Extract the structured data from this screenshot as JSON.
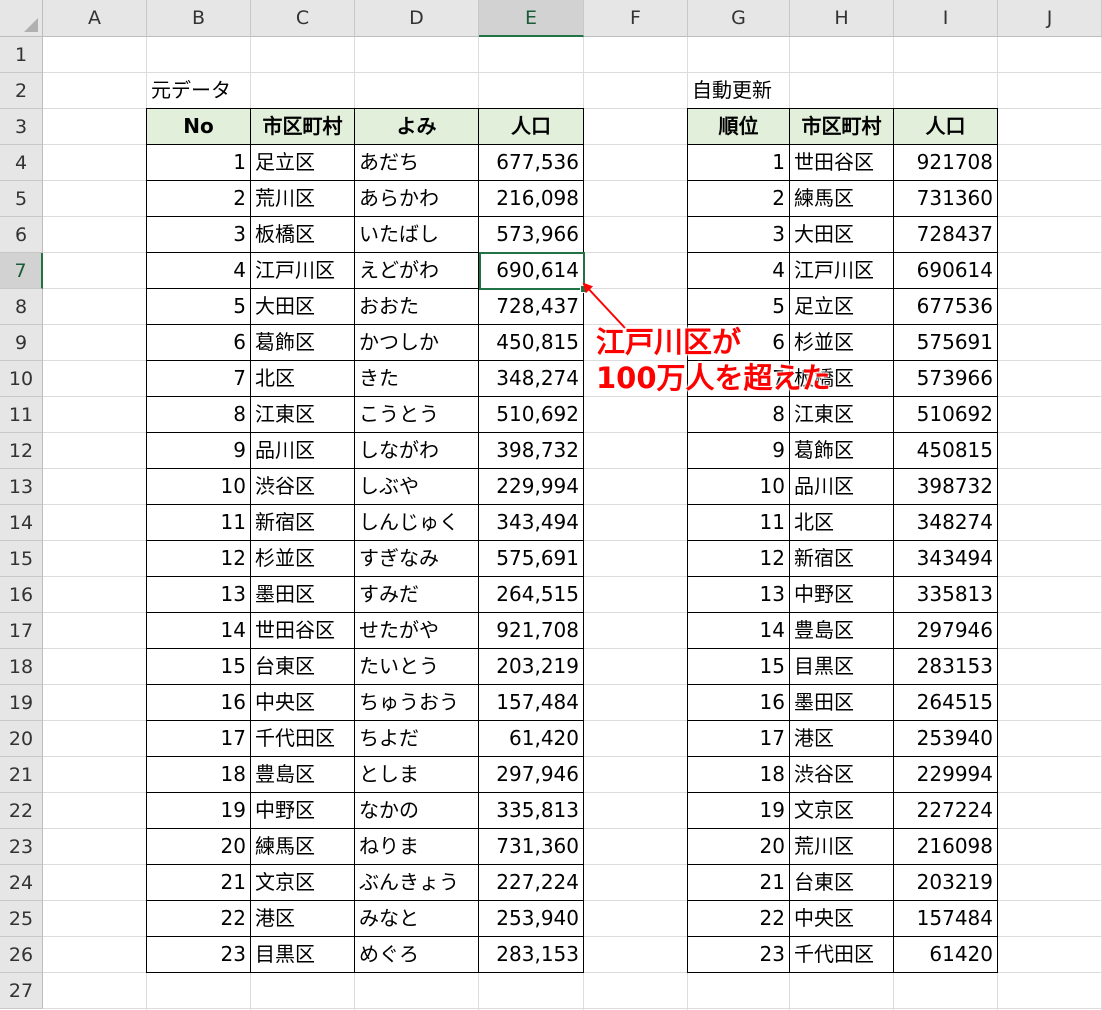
{
  "columns": [
    "A",
    "B",
    "C",
    "D",
    "E",
    "F",
    "G",
    "H",
    "I",
    "J"
  ],
  "rows": [
    "1",
    "2",
    "3",
    "4",
    "5",
    "6",
    "7",
    "8",
    "9",
    "10",
    "11",
    "12",
    "13",
    "14",
    "15",
    "16",
    "17",
    "18",
    "19",
    "20",
    "21",
    "22",
    "23",
    "24",
    "25",
    "26",
    "27"
  ],
  "selected": {
    "column": "E",
    "row": "7"
  },
  "left_table": {
    "title": "元データ",
    "headers": [
      "No",
      "市区町村",
      "よみ",
      "人口"
    ],
    "rows": [
      [
        "1",
        "足立区",
        "あだち",
        "677,536"
      ],
      [
        "2",
        "荒川区",
        "あらかわ",
        "216,098"
      ],
      [
        "3",
        "板橋区",
        "いたばし",
        "573,966"
      ],
      [
        "4",
        "江戸川区",
        "えどがわ",
        "690,614"
      ],
      [
        "5",
        "大田区",
        "おおた",
        "728,437"
      ],
      [
        "6",
        "葛飾区",
        "かつしか",
        "450,815"
      ],
      [
        "7",
        "北区",
        "きた",
        "348,274"
      ],
      [
        "8",
        "江東区",
        "こうとう",
        "510,692"
      ],
      [
        "9",
        "品川区",
        "しながわ",
        "398,732"
      ],
      [
        "10",
        "渋谷区",
        "しぶや",
        "229,994"
      ],
      [
        "11",
        "新宿区",
        "しんじゅく",
        "343,494"
      ],
      [
        "12",
        "杉並区",
        "すぎなみ",
        "575,691"
      ],
      [
        "13",
        "墨田区",
        "すみだ",
        "264,515"
      ],
      [
        "14",
        "世田谷区",
        "せたがや",
        "921,708"
      ],
      [
        "15",
        "台東区",
        "たいとう",
        "203,219"
      ],
      [
        "16",
        "中央区",
        "ちゅうおう",
        "157,484"
      ],
      [
        "17",
        "千代田区",
        "ちよだ",
        "61,420"
      ],
      [
        "18",
        "豊島区",
        "としま",
        "297,946"
      ],
      [
        "19",
        "中野区",
        "なかの",
        "335,813"
      ],
      [
        "20",
        "練馬区",
        "ねりま",
        "731,360"
      ],
      [
        "21",
        "文京区",
        "ぶんきょう",
        "227,224"
      ],
      [
        "22",
        "港区",
        "みなと",
        "253,940"
      ],
      [
        "23",
        "目黒区",
        "めぐろ",
        "283,153"
      ]
    ]
  },
  "right_table": {
    "title": "自動更新",
    "headers": [
      "順位",
      "市区町村",
      "人口"
    ],
    "rows": [
      [
        "1",
        "世田谷区",
        "921708"
      ],
      [
        "2",
        "練馬区",
        "731360"
      ],
      [
        "3",
        "大田区",
        "728437"
      ],
      [
        "4",
        "江戸川区",
        "690614"
      ],
      [
        "5",
        "足立区",
        "677536"
      ],
      [
        "6",
        "杉並区",
        "575691"
      ],
      [
        "7",
        "板橋区",
        "573966"
      ],
      [
        "8",
        "江東区",
        "510692"
      ],
      [
        "9",
        "葛飾区",
        "450815"
      ],
      [
        "10",
        "品川区",
        "398732"
      ],
      [
        "11",
        "北区",
        "348274"
      ],
      [
        "12",
        "新宿区",
        "343494"
      ],
      [
        "13",
        "中野区",
        "335813"
      ],
      [
        "14",
        "豊島区",
        "297946"
      ],
      [
        "15",
        "目黒区",
        "283153"
      ],
      [
        "16",
        "墨田区",
        "264515"
      ],
      [
        "17",
        "港区",
        "253940"
      ],
      [
        "18",
        "渋谷区",
        "229994"
      ],
      [
        "19",
        "文京区",
        "227224"
      ],
      [
        "20",
        "荒川区",
        "216098"
      ],
      [
        "21",
        "台東区",
        "203219"
      ],
      [
        "22",
        "中央区",
        "157484"
      ],
      [
        "23",
        "千代田区",
        "61420"
      ]
    ]
  },
  "annotation": {
    "line1": "江戸川区が",
    "line2": "100万人を超えた",
    "color": "#ff0000"
  },
  "colors": {
    "header_fill": "#e2efda",
    "selection": "#217346"
  }
}
